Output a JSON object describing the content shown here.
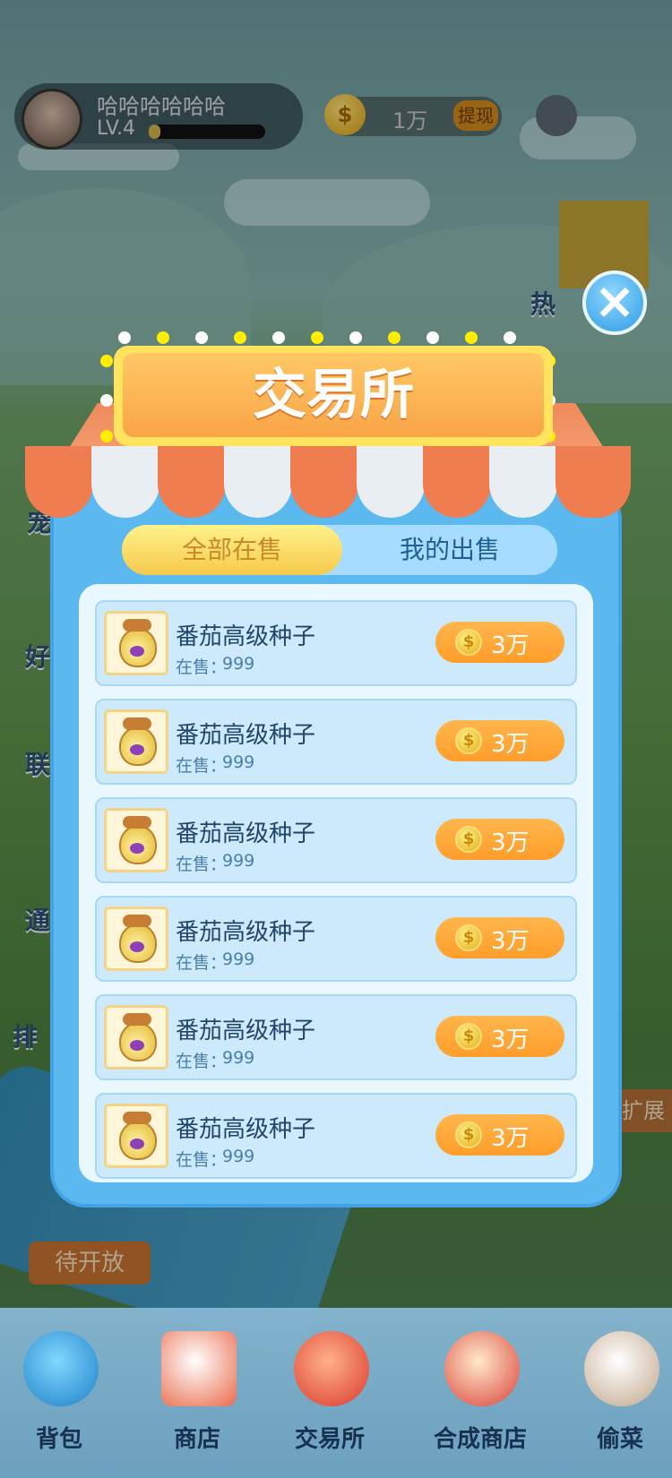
{
  "player": {
    "name": "哈哈哈哈哈哈",
    "level": "LV.4",
    "xp_fraction": 0.1
  },
  "currency": {
    "icon": "gold-coin-icon",
    "value": "1万",
    "withdraw_label": "提现"
  },
  "side_menu": {
    "hot_label": "热",
    "pet_label": "宠",
    "friend_label": "好",
    "union_label": "联",
    "notice_label": "通",
    "rank_label": "排"
  },
  "modal": {
    "title": "交易所",
    "tabs": [
      {
        "label": "全部在售",
        "active": true
      },
      {
        "label": "我的出售",
        "active": false
      }
    ],
    "items": [
      {
        "name": "番茄高级种子",
        "stock_label": "在售：",
        "stock": "999",
        "price": "3万"
      },
      {
        "name": "番茄高级种子",
        "stock_label": "在售：",
        "stock": "999",
        "price": "3万"
      },
      {
        "name": "番茄高级种子",
        "stock_label": "在售：",
        "stock": "999",
        "price": "3万"
      },
      {
        "name": "番茄高级种子",
        "stock_label": "在售：",
        "stock": "999",
        "price": "3万"
      },
      {
        "name": "番茄高级种子",
        "stock_label": "在售：",
        "stock": "999",
        "price": "3万"
      },
      {
        "name": "番茄高级种子",
        "stock_label": "在售：",
        "stock": "999",
        "price": "3万"
      }
    ]
  },
  "map": {
    "pending_label": "待开放",
    "expand_label": "扩展"
  },
  "bottom_nav": [
    {
      "label": "背包",
      "icon": "backpack-icon"
    },
    {
      "label": "商店",
      "icon": "shop-icon"
    },
    {
      "label": "交易所",
      "icon": "money-bag-icon"
    },
    {
      "label": "合成商店",
      "icon": "house-icon"
    },
    {
      "label": "偷菜",
      "icon": "glove-hand-icon"
    }
  ],
  "colors": {
    "panel": "#5bb9f0",
    "tab_active": "#f6c94c",
    "price_button": "#ff9d2a",
    "title_sign": "#f9a447"
  }
}
